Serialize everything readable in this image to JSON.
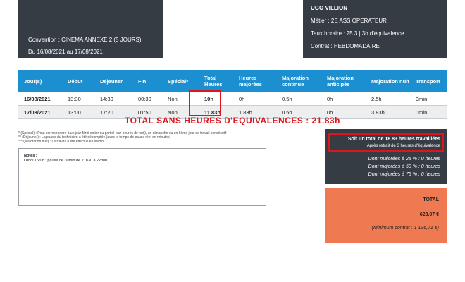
{
  "header_left": {
    "convention": "Convention : CINEMA ANNEXE 2 (5 JOURS)",
    "period": "Du 16/08/2021 au 17/08/2021"
  },
  "header_right": {
    "name": "UGO VILLION",
    "metier": "Métier : 2E ASS OPERATEUR",
    "taux": "Taux horaire : 25.3 | 3h d'équivalence",
    "contrat": "Contrat : HEBDOMADAIRE"
  },
  "table": {
    "headers": [
      "Jour(s)",
      "Début",
      "Déjeuner",
      "Fin",
      "Spécial*",
      "Total Heures",
      "Heures majorées",
      "Majoration continue",
      "Majoration anticipée",
      "Majoration nuit",
      "Transport"
    ],
    "rows": [
      [
        "16/08/2021",
        "13:30",
        "14:30",
        "00:30",
        "Non",
        "10h",
        "0h",
        "0.5h",
        "0h",
        "2.5h",
        "0min"
      ],
      [
        "17/08/2021",
        "13:00",
        "17:20",
        "01:50",
        "Non",
        "11.83h",
        "1.83h",
        "0.5h",
        "0h",
        "3.83h",
        "0min"
      ]
    ]
  },
  "total_sans": "TOTAL SANS HEURES D'EQUIVALENCES : 21.83h",
  "footnotes": [
    "* (Spécial) : Peut correspondre à un jour férié entier ou partiel (sur heures de nuit), un dimanche ou un 6ème jour de travail consécutif",
    "** (Déjeuner) : La pause du technicien a été décomptée (avec le temps de pause réel en minutes)",
    "*** (Majoration nuit) : Le travail a été effectué en studio"
  ],
  "notes": {
    "title": "Notes :",
    "text": "Lundi 16/08 : pause de 30min de 21h30 à 22h00"
  },
  "summary": {
    "line1": "Soit un total de 18.83 heures travaillées",
    "line2": "Après retrait de 3 heures d'équivalence",
    "maj25": "Dont majorées à 25 % : 0 heures",
    "maj50": "Dont majorées à 50 % : 0 heures",
    "maj75": "Dont majorées à 75 % : 0 heures"
  },
  "total": {
    "label": "TOTAL",
    "amount": "628,07 €",
    "minimum": "(Minimum contrat : 1 136,71 €)"
  },
  "colors": {
    "header_dark": "#353c44",
    "table_header": "#1b8fd0",
    "highlight_red": "#e0141b",
    "total_orange": "#ef7a52"
  }
}
